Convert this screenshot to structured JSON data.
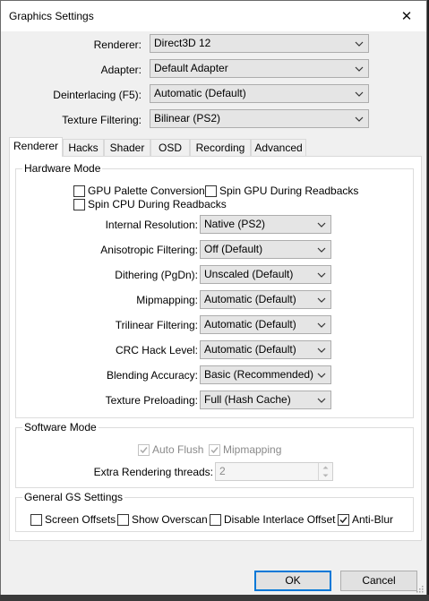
{
  "window": {
    "title": "Graphics Settings",
    "close_glyph": "✕"
  },
  "top": {
    "renderer": {
      "label": "Renderer:",
      "value": "Direct3D 12"
    },
    "adapter": {
      "label": "Adapter:",
      "value": "Default Adapter"
    },
    "deinterlacing": {
      "label": "Deinterlacing (F5):",
      "value": "Automatic (Default)"
    },
    "texture_filtering": {
      "label": "Texture Filtering:",
      "value": "Bilinear (PS2)"
    }
  },
  "tabs": [
    "Renderer",
    "Hacks",
    "Shader",
    "OSD",
    "Recording",
    "Advanced"
  ],
  "active_tab": "Renderer",
  "hardware": {
    "title": "Hardware Mode",
    "gpu_palette": {
      "label": "GPU Palette Conversion",
      "checked": false
    },
    "spin_gpu": {
      "label": "Spin GPU During Readbacks",
      "checked": false
    },
    "spin_cpu": {
      "label": "Spin CPU During Readbacks",
      "checked": false
    },
    "rows": [
      {
        "label": "Internal Resolution:",
        "value": "Native (PS2)"
      },
      {
        "label": "Anisotropic Filtering:",
        "value": "Off (Default)"
      },
      {
        "label": "Dithering (PgDn):",
        "value": "Unscaled (Default)"
      },
      {
        "label": "Mipmapping:",
        "value": "Automatic (Default)"
      },
      {
        "label": "Trilinear Filtering:",
        "value": "Automatic (Default)"
      },
      {
        "label": "CRC Hack Level:",
        "value": "Automatic (Default)"
      },
      {
        "label": "Blending Accuracy:",
        "value": "Basic (Recommended)"
      },
      {
        "label": "Texture Preloading:",
        "value": "Full (Hash Cache)"
      }
    ]
  },
  "software": {
    "title": "Software Mode",
    "auto_flush": {
      "label": "Auto Flush",
      "checked": true
    },
    "mipmapping": {
      "label": "Mipmapping",
      "checked": true
    },
    "threads": {
      "label": "Extra Rendering threads:",
      "value": "2"
    }
  },
  "general": {
    "title": "General GS Settings",
    "screen_offsets": {
      "label": "Screen Offsets",
      "checked": false
    },
    "show_overscan": {
      "label": "Show Overscan",
      "checked": false
    },
    "disable_interlace": {
      "label": "Disable Interlace Offset",
      "checked": false
    },
    "anti_blur": {
      "label": "Anti-Blur",
      "checked": true
    }
  },
  "buttons": {
    "ok": "OK",
    "cancel": "Cancel"
  },
  "icons": {
    "dropdown": "chevron-down-icon",
    "check": "check-icon",
    "close": "close-icon"
  },
  "colors": {
    "window_bg": "#f0f0f0",
    "panel_bg": "#ffffff",
    "focus_border": "#0078d7"
  }
}
